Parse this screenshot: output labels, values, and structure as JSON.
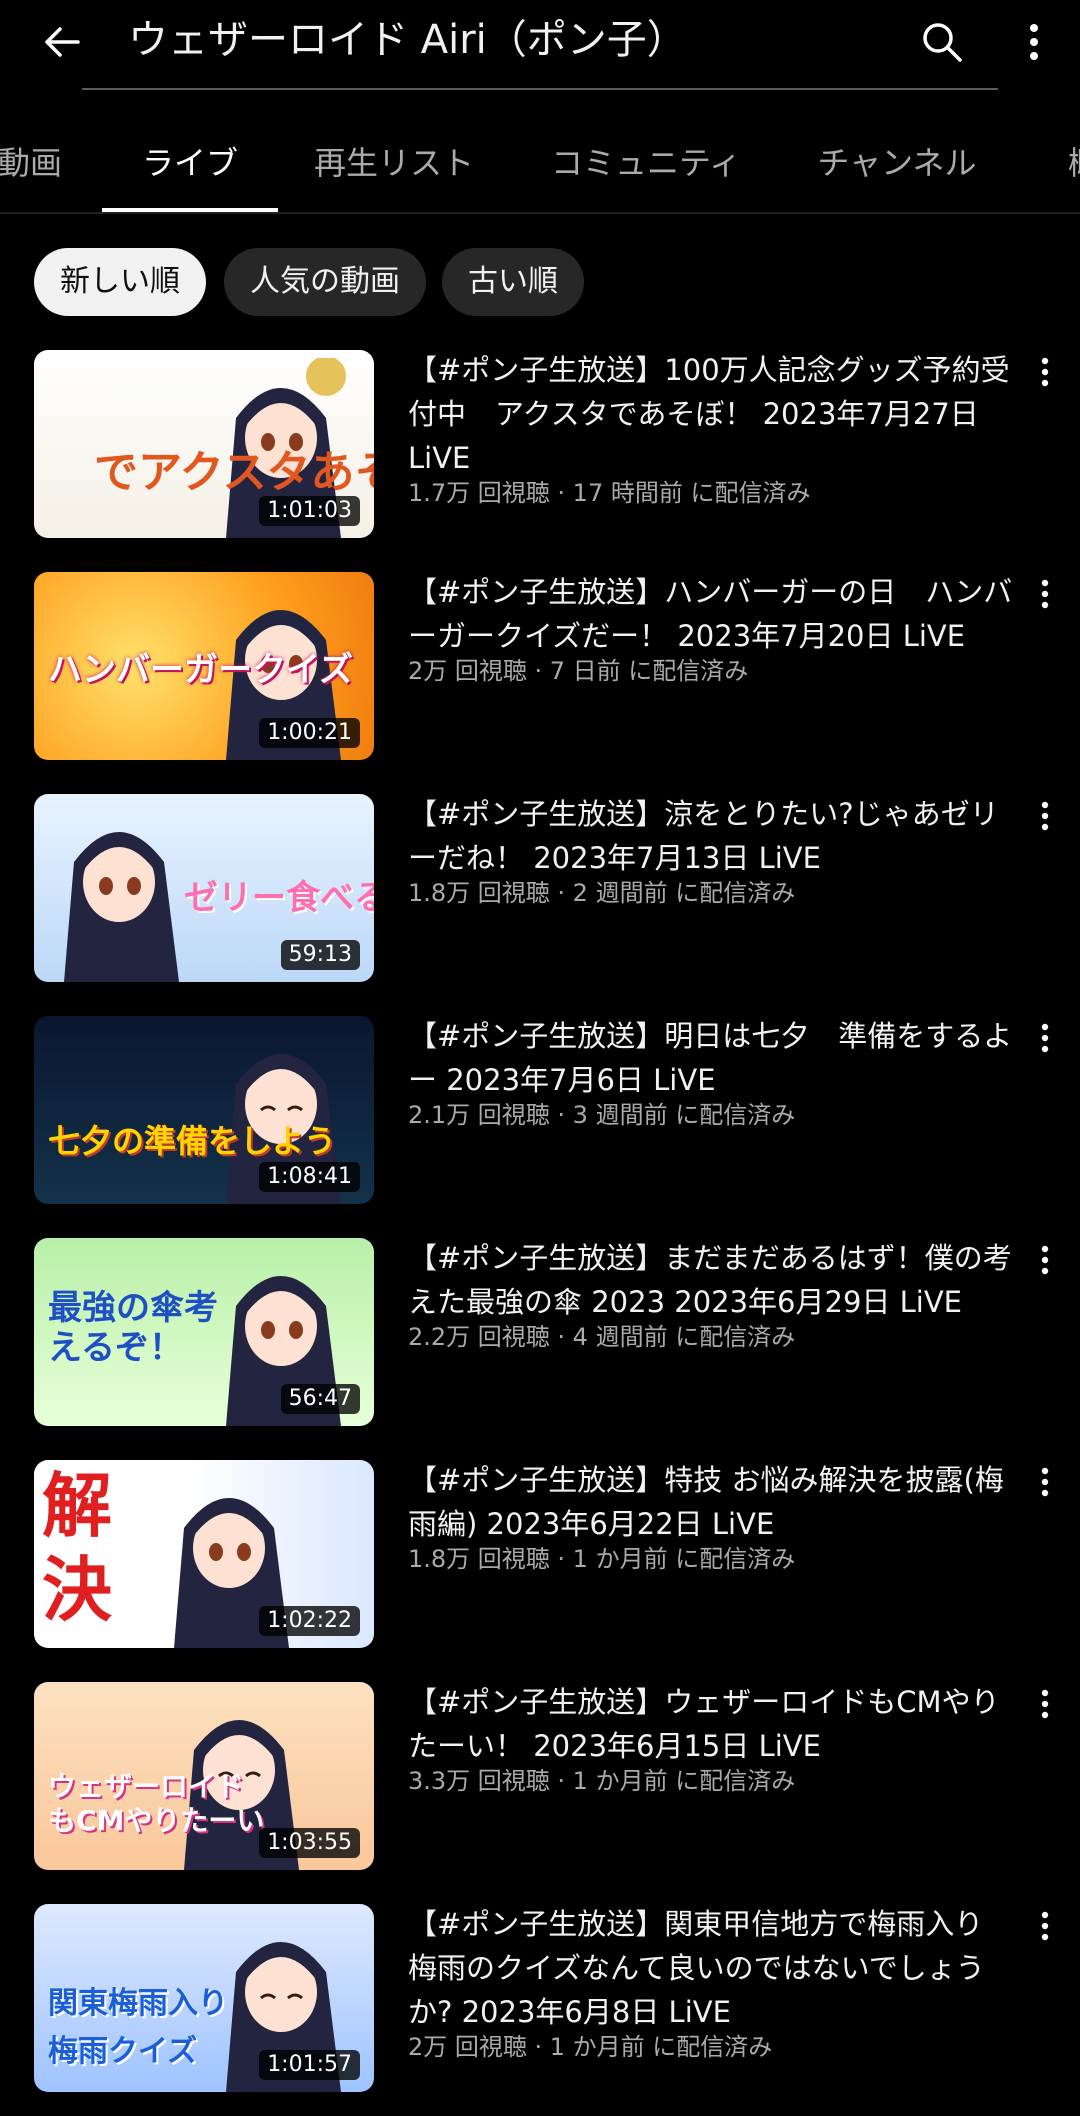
{
  "header": {
    "title": "ウェザーロイド Airi（ポン子）"
  },
  "tabs": [
    {
      "label": "動画"
    },
    {
      "label": "ライブ"
    },
    {
      "label": "再生リスト"
    },
    {
      "label": "コミュニティ"
    },
    {
      "label": "チャンネル"
    },
    {
      "label": "概"
    }
  ],
  "chips": [
    {
      "label": "新しい順"
    },
    {
      "label": "人気の動画"
    },
    {
      "label": "古い順"
    }
  ],
  "videos": [
    {
      "title": "【#ポン子生放送】100万人記念グッズ予約受付中　アクスタであそぼ！ 2023年7月27日 LiVE",
      "meta": "1.7万 回視聴 · 17 時間前 に配信済み",
      "duration": "1:01:03",
      "caption": "でアクスタあそぼ！"
    },
    {
      "title": "【#ポン子生放送】ハンバーガーの日　ハンバーガークイズだー！ 2023年7月20日 LiVE",
      "meta": "2万 回視聴 · 7 日前 に配信済み",
      "duration": "1:00:21",
      "caption": "ハンバーガークイズ"
    },
    {
      "title": "【#ポン子生放送】涼をとりたい?じゃあゼリーだね！ 2023年7月13日 LiVE",
      "meta": "1.8万 回視聴 · 2 週間前 に配信済み",
      "duration": "59:13",
      "caption": "ゼリー食べる"
    },
    {
      "title": "【#ポン子生放送】明日は七夕　準備をするよー 2023年7月6日 LiVE",
      "meta": "2.1万 回視聴 · 3 週間前 に配信済み",
      "duration": "1:08:41",
      "caption": "七夕の準備をしよう"
    },
    {
      "title": "【#ポン子生放送】まだまだあるはず！僕の考えた最強の傘 2023 2023年6月29日 LiVE",
      "meta": "2.2万 回視聴 · 4 週間前 に配信済み",
      "duration": "56:47",
      "caption": "最強の傘考えるぞ！"
    },
    {
      "title": "【#ポン子生放送】特技 お悩み解決を披露(梅雨編) 2023年6月22日 LiVE",
      "meta": "1.8万 回視聴 · 1 か月前 に配信済み",
      "duration": "1:02:22",
      "caption": "解決"
    },
    {
      "title": "【#ポン子生放送】ウェザーロイドもCMやりたーい！ 2023年6月15日 LiVE",
      "meta": "3.3万 回視聴 · 1 か月前 に配信済み",
      "duration": "1:03:55",
      "caption": "ウェザーロイドもCMやりたーい"
    },
    {
      "title": "【#ポン子生放送】関東甲信地方で梅雨入り　梅雨のクイズなんて良いのではないでしょうか? 2023年6月8日 LiVE",
      "meta": "2万 回視聴 · 1 か月前 に配信済み",
      "duration": "1:01:57",
      "caption": "関東梅雨入り 梅雨クイズ"
    }
  ],
  "icons": {
    "back": "arrow-left-icon",
    "search": "search-icon",
    "more": "more-vert-icon"
  }
}
